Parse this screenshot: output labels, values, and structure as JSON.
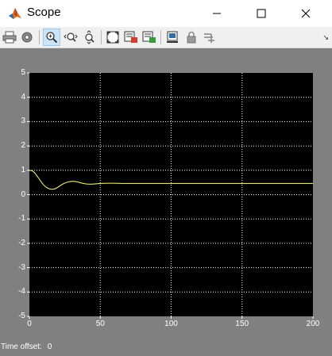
{
  "window": {
    "title": "Scope",
    "icon": "matlab-logo-icon"
  },
  "toolbar": {
    "buttons": [
      {
        "name": "print-icon"
      },
      {
        "name": "parameters-gear-icon"
      },
      {
        "name": "zoom-in-icon",
        "active": true
      },
      {
        "name": "zoom-x-icon"
      },
      {
        "name": "zoom-y-icon"
      },
      {
        "name": "autoscale-icon"
      },
      {
        "name": "save-axes-settings-icon"
      },
      {
        "name": "restore-axes-settings-icon"
      },
      {
        "name": "floating-scope-icon"
      },
      {
        "name": "lock-axes-icon"
      },
      {
        "name": "signal-selection-icon"
      }
    ],
    "more_glyph": "↘"
  },
  "status": {
    "time_offset_label": "Time offset:",
    "time_offset_value": "0"
  },
  "colors": {
    "plot_background": "#000000",
    "scope_background": "#808080",
    "trace": "#ffff80",
    "grid": "#ffffff"
  },
  "chart_data": {
    "type": "line",
    "x_ticks": [
      "0",
      "50",
      "100",
      "150",
      "200"
    ],
    "y_ticks": [
      "5",
      "4",
      "3",
      "2",
      "1",
      "0",
      "-1",
      "-2",
      "-3",
      "-4",
      "-5"
    ],
    "xlim": [
      0,
      200
    ],
    "ylim": [
      -5,
      5
    ],
    "grid": true,
    "series": [
      {
        "x": [
          0,
          2,
          4,
          6,
          8,
          10,
          12,
          14,
          16,
          18,
          20,
          22,
          24,
          26,
          28,
          30,
          32,
          34,
          36,
          38,
          40,
          42,
          44,
          46,
          48,
          50,
          55,
          60,
          65,
          70,
          80,
          90,
          100,
          120,
          150,
          180,
          200
        ],
        "y": [
          1.0,
          0.98,
          0.88,
          0.72,
          0.55,
          0.4,
          0.3,
          0.24,
          0.22,
          0.24,
          0.3,
          0.38,
          0.45,
          0.5,
          0.53,
          0.55,
          0.54,
          0.52,
          0.49,
          0.46,
          0.44,
          0.43,
          0.43,
          0.44,
          0.45,
          0.46,
          0.47,
          0.47,
          0.46,
          0.46,
          0.46,
          0.46,
          0.46,
          0.46,
          0.46,
          0.46,
          0.46
        ]
      }
    ]
  }
}
